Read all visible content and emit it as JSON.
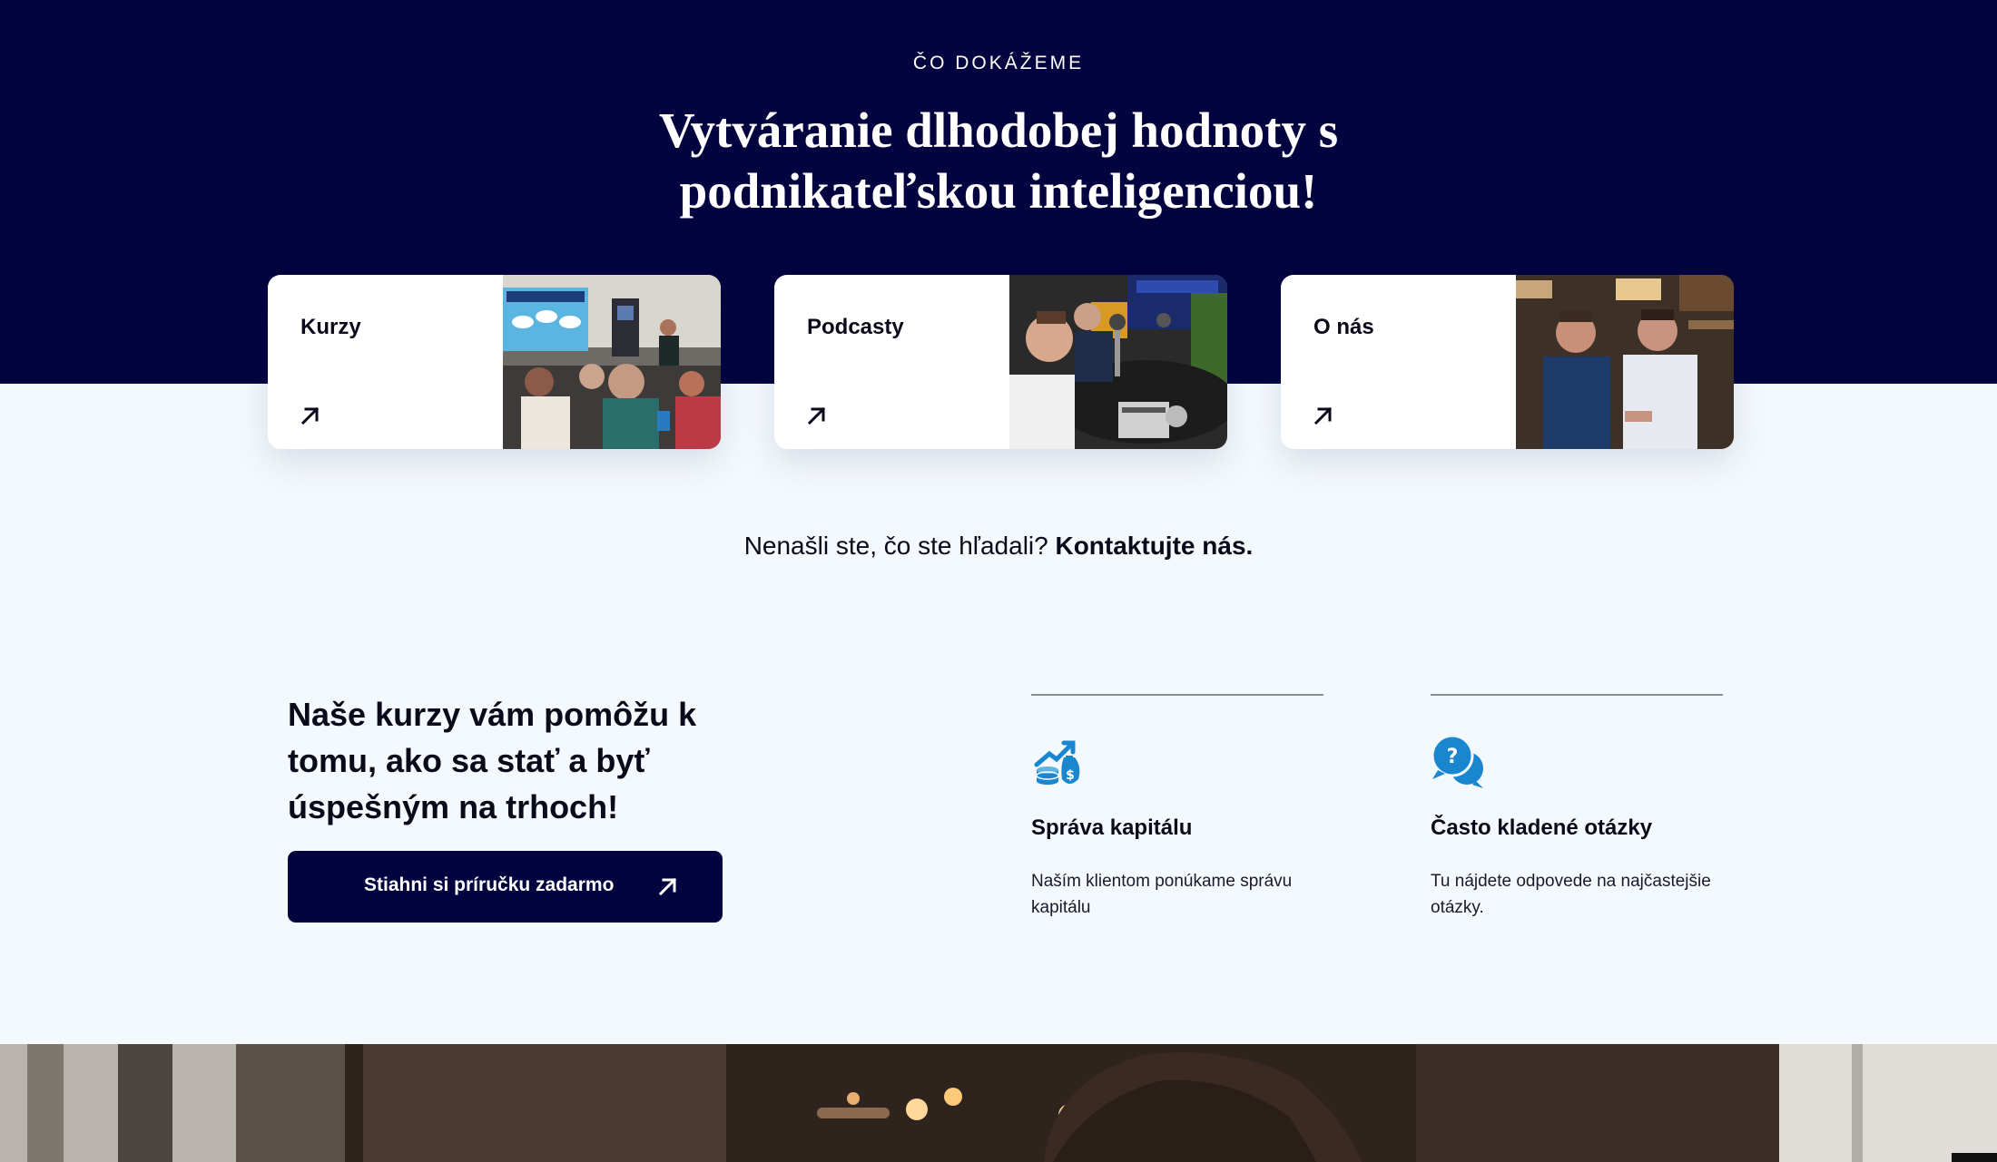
{
  "hero": {
    "eyebrow": "ČO DOKÁŽEME",
    "title_line1": "Vytváranie dlhodobej hodnoty s",
    "title_line2": "podnikateľskou inteligenciou!",
    "background_color": "#03033f"
  },
  "cards": [
    {
      "label": "Kurzy",
      "icon": "arrow-up-right-icon",
      "image": "seminar-photo"
    },
    {
      "label": "Podcasty",
      "icon": "arrow-up-right-icon",
      "image": "podcast-studio-photo"
    },
    {
      "label": "O nás",
      "icon": "arrow-up-right-icon",
      "image": "team-photo"
    }
  ],
  "contact": {
    "text": "Nenašli ste, čo ste hľadali?",
    "link": "Kontaktujte nás."
  },
  "promo": {
    "title": "Naše kurzy vám pomôžu k tomu, ako sa stať a byť úspešným na trhoch!",
    "cta_label": "Stiahni si príručku zadarmo",
    "cta_icon": "arrow-up-right-icon"
  },
  "features": [
    {
      "icon": "money-growth-icon",
      "title": "Správa kapitálu",
      "description": "Naším klientom ponúkame správu kapitálu"
    },
    {
      "icon": "question-chat-icon",
      "title": "Často kladené otázky",
      "description": "Tu nájdete odpovede na najčastejšie otázky."
    }
  ],
  "colors": {
    "navy": "#03033f",
    "accent_blue": "#1a86d0",
    "page_background": "#f4f9fd"
  }
}
